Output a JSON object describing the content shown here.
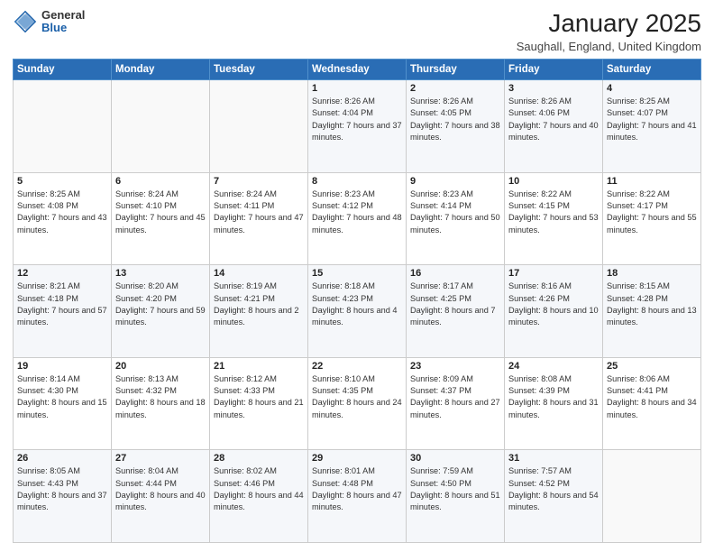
{
  "logo": {
    "general": "General",
    "blue": "Blue"
  },
  "header": {
    "title": "January 2025",
    "subtitle": "Saughall, England, United Kingdom"
  },
  "weekdays": [
    "Sunday",
    "Monday",
    "Tuesday",
    "Wednesday",
    "Thursday",
    "Friday",
    "Saturday"
  ],
  "weeks": [
    [
      {
        "day": "",
        "sunrise": "",
        "sunset": "",
        "daylight": ""
      },
      {
        "day": "",
        "sunrise": "",
        "sunset": "",
        "daylight": ""
      },
      {
        "day": "",
        "sunrise": "",
        "sunset": "",
        "daylight": ""
      },
      {
        "day": "1",
        "sunrise": "Sunrise: 8:26 AM",
        "sunset": "Sunset: 4:04 PM",
        "daylight": "Daylight: 7 hours and 37 minutes."
      },
      {
        "day": "2",
        "sunrise": "Sunrise: 8:26 AM",
        "sunset": "Sunset: 4:05 PM",
        "daylight": "Daylight: 7 hours and 38 minutes."
      },
      {
        "day": "3",
        "sunrise": "Sunrise: 8:26 AM",
        "sunset": "Sunset: 4:06 PM",
        "daylight": "Daylight: 7 hours and 40 minutes."
      },
      {
        "day": "4",
        "sunrise": "Sunrise: 8:25 AM",
        "sunset": "Sunset: 4:07 PM",
        "daylight": "Daylight: 7 hours and 41 minutes."
      }
    ],
    [
      {
        "day": "5",
        "sunrise": "Sunrise: 8:25 AM",
        "sunset": "Sunset: 4:08 PM",
        "daylight": "Daylight: 7 hours and 43 minutes."
      },
      {
        "day": "6",
        "sunrise": "Sunrise: 8:24 AM",
        "sunset": "Sunset: 4:10 PM",
        "daylight": "Daylight: 7 hours and 45 minutes."
      },
      {
        "day": "7",
        "sunrise": "Sunrise: 8:24 AM",
        "sunset": "Sunset: 4:11 PM",
        "daylight": "Daylight: 7 hours and 47 minutes."
      },
      {
        "day": "8",
        "sunrise": "Sunrise: 8:23 AM",
        "sunset": "Sunset: 4:12 PM",
        "daylight": "Daylight: 7 hours and 48 minutes."
      },
      {
        "day": "9",
        "sunrise": "Sunrise: 8:23 AM",
        "sunset": "Sunset: 4:14 PM",
        "daylight": "Daylight: 7 hours and 50 minutes."
      },
      {
        "day": "10",
        "sunrise": "Sunrise: 8:22 AM",
        "sunset": "Sunset: 4:15 PM",
        "daylight": "Daylight: 7 hours and 53 minutes."
      },
      {
        "day": "11",
        "sunrise": "Sunrise: 8:22 AM",
        "sunset": "Sunset: 4:17 PM",
        "daylight": "Daylight: 7 hours and 55 minutes."
      }
    ],
    [
      {
        "day": "12",
        "sunrise": "Sunrise: 8:21 AM",
        "sunset": "Sunset: 4:18 PM",
        "daylight": "Daylight: 7 hours and 57 minutes."
      },
      {
        "day": "13",
        "sunrise": "Sunrise: 8:20 AM",
        "sunset": "Sunset: 4:20 PM",
        "daylight": "Daylight: 7 hours and 59 minutes."
      },
      {
        "day": "14",
        "sunrise": "Sunrise: 8:19 AM",
        "sunset": "Sunset: 4:21 PM",
        "daylight": "Daylight: 8 hours and 2 minutes."
      },
      {
        "day": "15",
        "sunrise": "Sunrise: 8:18 AM",
        "sunset": "Sunset: 4:23 PM",
        "daylight": "Daylight: 8 hours and 4 minutes."
      },
      {
        "day": "16",
        "sunrise": "Sunrise: 8:17 AM",
        "sunset": "Sunset: 4:25 PM",
        "daylight": "Daylight: 8 hours and 7 minutes."
      },
      {
        "day": "17",
        "sunrise": "Sunrise: 8:16 AM",
        "sunset": "Sunset: 4:26 PM",
        "daylight": "Daylight: 8 hours and 10 minutes."
      },
      {
        "day": "18",
        "sunrise": "Sunrise: 8:15 AM",
        "sunset": "Sunset: 4:28 PM",
        "daylight": "Daylight: 8 hours and 13 minutes."
      }
    ],
    [
      {
        "day": "19",
        "sunrise": "Sunrise: 8:14 AM",
        "sunset": "Sunset: 4:30 PM",
        "daylight": "Daylight: 8 hours and 15 minutes."
      },
      {
        "day": "20",
        "sunrise": "Sunrise: 8:13 AM",
        "sunset": "Sunset: 4:32 PM",
        "daylight": "Daylight: 8 hours and 18 minutes."
      },
      {
        "day": "21",
        "sunrise": "Sunrise: 8:12 AM",
        "sunset": "Sunset: 4:33 PM",
        "daylight": "Daylight: 8 hours and 21 minutes."
      },
      {
        "day": "22",
        "sunrise": "Sunrise: 8:10 AM",
        "sunset": "Sunset: 4:35 PM",
        "daylight": "Daylight: 8 hours and 24 minutes."
      },
      {
        "day": "23",
        "sunrise": "Sunrise: 8:09 AM",
        "sunset": "Sunset: 4:37 PM",
        "daylight": "Daylight: 8 hours and 27 minutes."
      },
      {
        "day": "24",
        "sunrise": "Sunrise: 8:08 AM",
        "sunset": "Sunset: 4:39 PM",
        "daylight": "Daylight: 8 hours and 31 minutes."
      },
      {
        "day": "25",
        "sunrise": "Sunrise: 8:06 AM",
        "sunset": "Sunset: 4:41 PM",
        "daylight": "Daylight: 8 hours and 34 minutes."
      }
    ],
    [
      {
        "day": "26",
        "sunrise": "Sunrise: 8:05 AM",
        "sunset": "Sunset: 4:43 PM",
        "daylight": "Daylight: 8 hours and 37 minutes."
      },
      {
        "day": "27",
        "sunrise": "Sunrise: 8:04 AM",
        "sunset": "Sunset: 4:44 PM",
        "daylight": "Daylight: 8 hours and 40 minutes."
      },
      {
        "day": "28",
        "sunrise": "Sunrise: 8:02 AM",
        "sunset": "Sunset: 4:46 PM",
        "daylight": "Daylight: 8 hours and 44 minutes."
      },
      {
        "day": "29",
        "sunrise": "Sunrise: 8:01 AM",
        "sunset": "Sunset: 4:48 PM",
        "daylight": "Daylight: 8 hours and 47 minutes."
      },
      {
        "day": "30",
        "sunrise": "Sunrise: 7:59 AM",
        "sunset": "Sunset: 4:50 PM",
        "daylight": "Daylight: 8 hours and 51 minutes."
      },
      {
        "day": "31",
        "sunrise": "Sunrise: 7:57 AM",
        "sunset": "Sunset: 4:52 PM",
        "daylight": "Daylight: 8 hours and 54 minutes."
      },
      {
        "day": "",
        "sunrise": "",
        "sunset": "",
        "daylight": ""
      }
    ]
  ]
}
